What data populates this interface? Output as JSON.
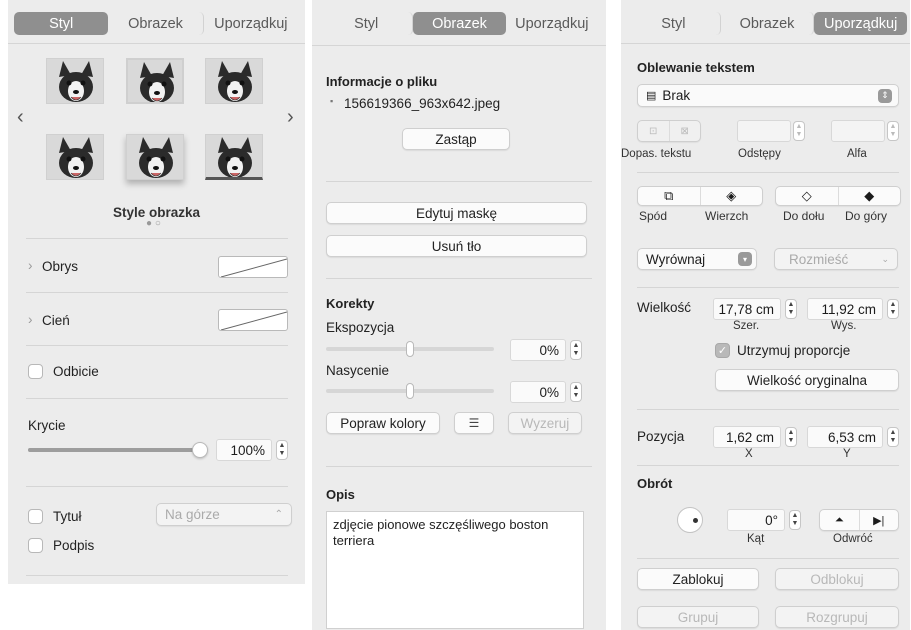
{
  "panel1": {
    "tabs": [
      "Styl",
      "Obrazek",
      "Uporządkuj"
    ],
    "style_caption": "Style obrazka",
    "outline_label": "Obrys",
    "shadow_label": "Cień",
    "reflection_label": "Odbicie",
    "opacity_label": "Krycie",
    "opacity_value": "100%",
    "opacity_fraction": 1.0,
    "title_label": "Tytuł",
    "title_position": "Na górze",
    "caption_label": "Podpis"
  },
  "panel2": {
    "tabs": [
      "Styl",
      "Obrazek",
      "Uporządkuj"
    ],
    "file_info_title": "Informacje o pliku",
    "file_name": "156619366_963x642.jpeg",
    "replace_button": "Zastąp",
    "edit_mask_button": "Edytuj maskę",
    "remove_bg_button": "Usuń tło",
    "adjustments_title": "Korekty",
    "exposure_label": "Ekspozycja",
    "exposure_value": "0%",
    "saturation_label": "Nasycenie",
    "saturation_value": "0%",
    "enhance_button": "Popraw kolory",
    "reset_button": "Wyzeruj",
    "description_title": "Opis",
    "description_text": "zdjęcie pionowe szczęśliwego boston terriera"
  },
  "panel3": {
    "tabs": [
      "Styl",
      "Obrazek",
      "Uporządkuj"
    ],
    "wrap_title": "Oblewanie tekstem",
    "wrap_value": "Brak",
    "fit_text_label": "Dopas. tekstu",
    "spacing_label": "Odstępy",
    "alpha_label": "Alfa",
    "back_label": "Spód",
    "front_label": "Wierzch",
    "backward_label": "Do dołu",
    "forward_label": "Do góry",
    "align_label": "Wyrównaj",
    "distribute_label": "Rozmieść",
    "size_label": "Wielkość",
    "width_value": "17,78 cm",
    "width_label": "Szer.",
    "height_value": "11,92 cm",
    "height_label": "Wys.",
    "constrain_label": "Utrzymuj proporcje",
    "original_size_button": "Wielkość oryginalna",
    "position_label": "Pozycja",
    "x_value": "1,62 cm",
    "x_label": "X",
    "y_value": "6,53 cm",
    "y_label": "Y",
    "rotation_title": "Obrót",
    "angle_value": "0°",
    "angle_label": "Kąt",
    "flip_label": "Odwróć",
    "lock_button": "Zablokuj",
    "unlock_button": "Odblokuj",
    "group_button": "Grupuj",
    "ungroup_button": "Rozgrupuj"
  },
  "colors": {
    "active_tab": "#8f8f8f",
    "panel_bg": "#ececec"
  }
}
